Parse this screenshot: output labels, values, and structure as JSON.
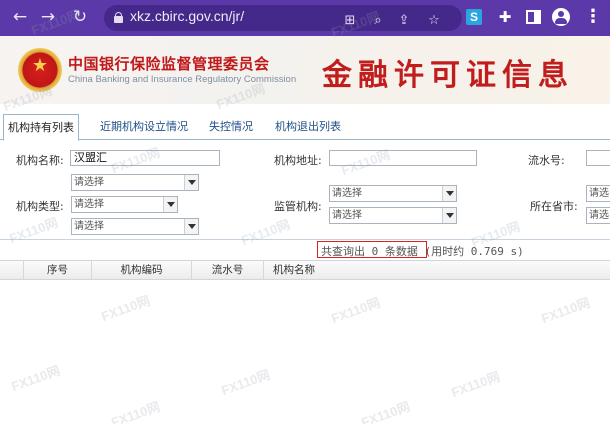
{
  "browser": {
    "url": "xkz.cbirc.gov.cn/jr/",
    "extension_letter": "S",
    "icons": [
      "back-arrow-icon",
      "forward-arrow-icon",
      "reload-icon",
      "lock-icon",
      "translate-icon",
      "zoom-icon",
      "share-icon",
      "star-icon",
      "extensions-icon",
      "side-panel-icon",
      "profile-icon",
      "menu-icon"
    ]
  },
  "banner": {
    "org_name_cn": "中国银行保险监督管理委员会",
    "org_name_en": "China Banking and Insurance Regulatory Commission",
    "title": "金融许可证信息"
  },
  "tabs": [
    {
      "label": "机构持有列表",
      "active": true
    },
    {
      "label": "近期机构设立情况",
      "active": false
    },
    {
      "label": "失控情况",
      "active": false
    },
    {
      "label": "机构退出列表",
      "active": false
    }
  ],
  "form": {
    "org_name_label": "机构名称:",
    "org_name_value": "汉盟汇",
    "org_address_label": "机构地址:",
    "org_address_value": "",
    "serial_no_label": "流水号:",
    "serial_no_value": "",
    "org_type_label": "机构类型:",
    "org_type_selects": [
      "请选择",
      "请选择",
      "请选择"
    ],
    "regulator_label": "监管机构:",
    "regulator_selects": [
      "请选择",
      "请选择"
    ],
    "province_label": "所在省市:",
    "province_selects": [
      "请选",
      "请选"
    ]
  },
  "result": {
    "text": "共查询出 0 条数据 (用时约 0.769 s)"
  },
  "table": {
    "headers": [
      "序号",
      "机构编码",
      "流水号",
      "机构名称"
    ],
    "rows": []
  },
  "watermark": "FX110网",
  "colors": {
    "chrome": "#5b39a8",
    "brand_red": "#c01818",
    "highlight_box": "#d62424",
    "link_blue": "#1f4f86"
  }
}
